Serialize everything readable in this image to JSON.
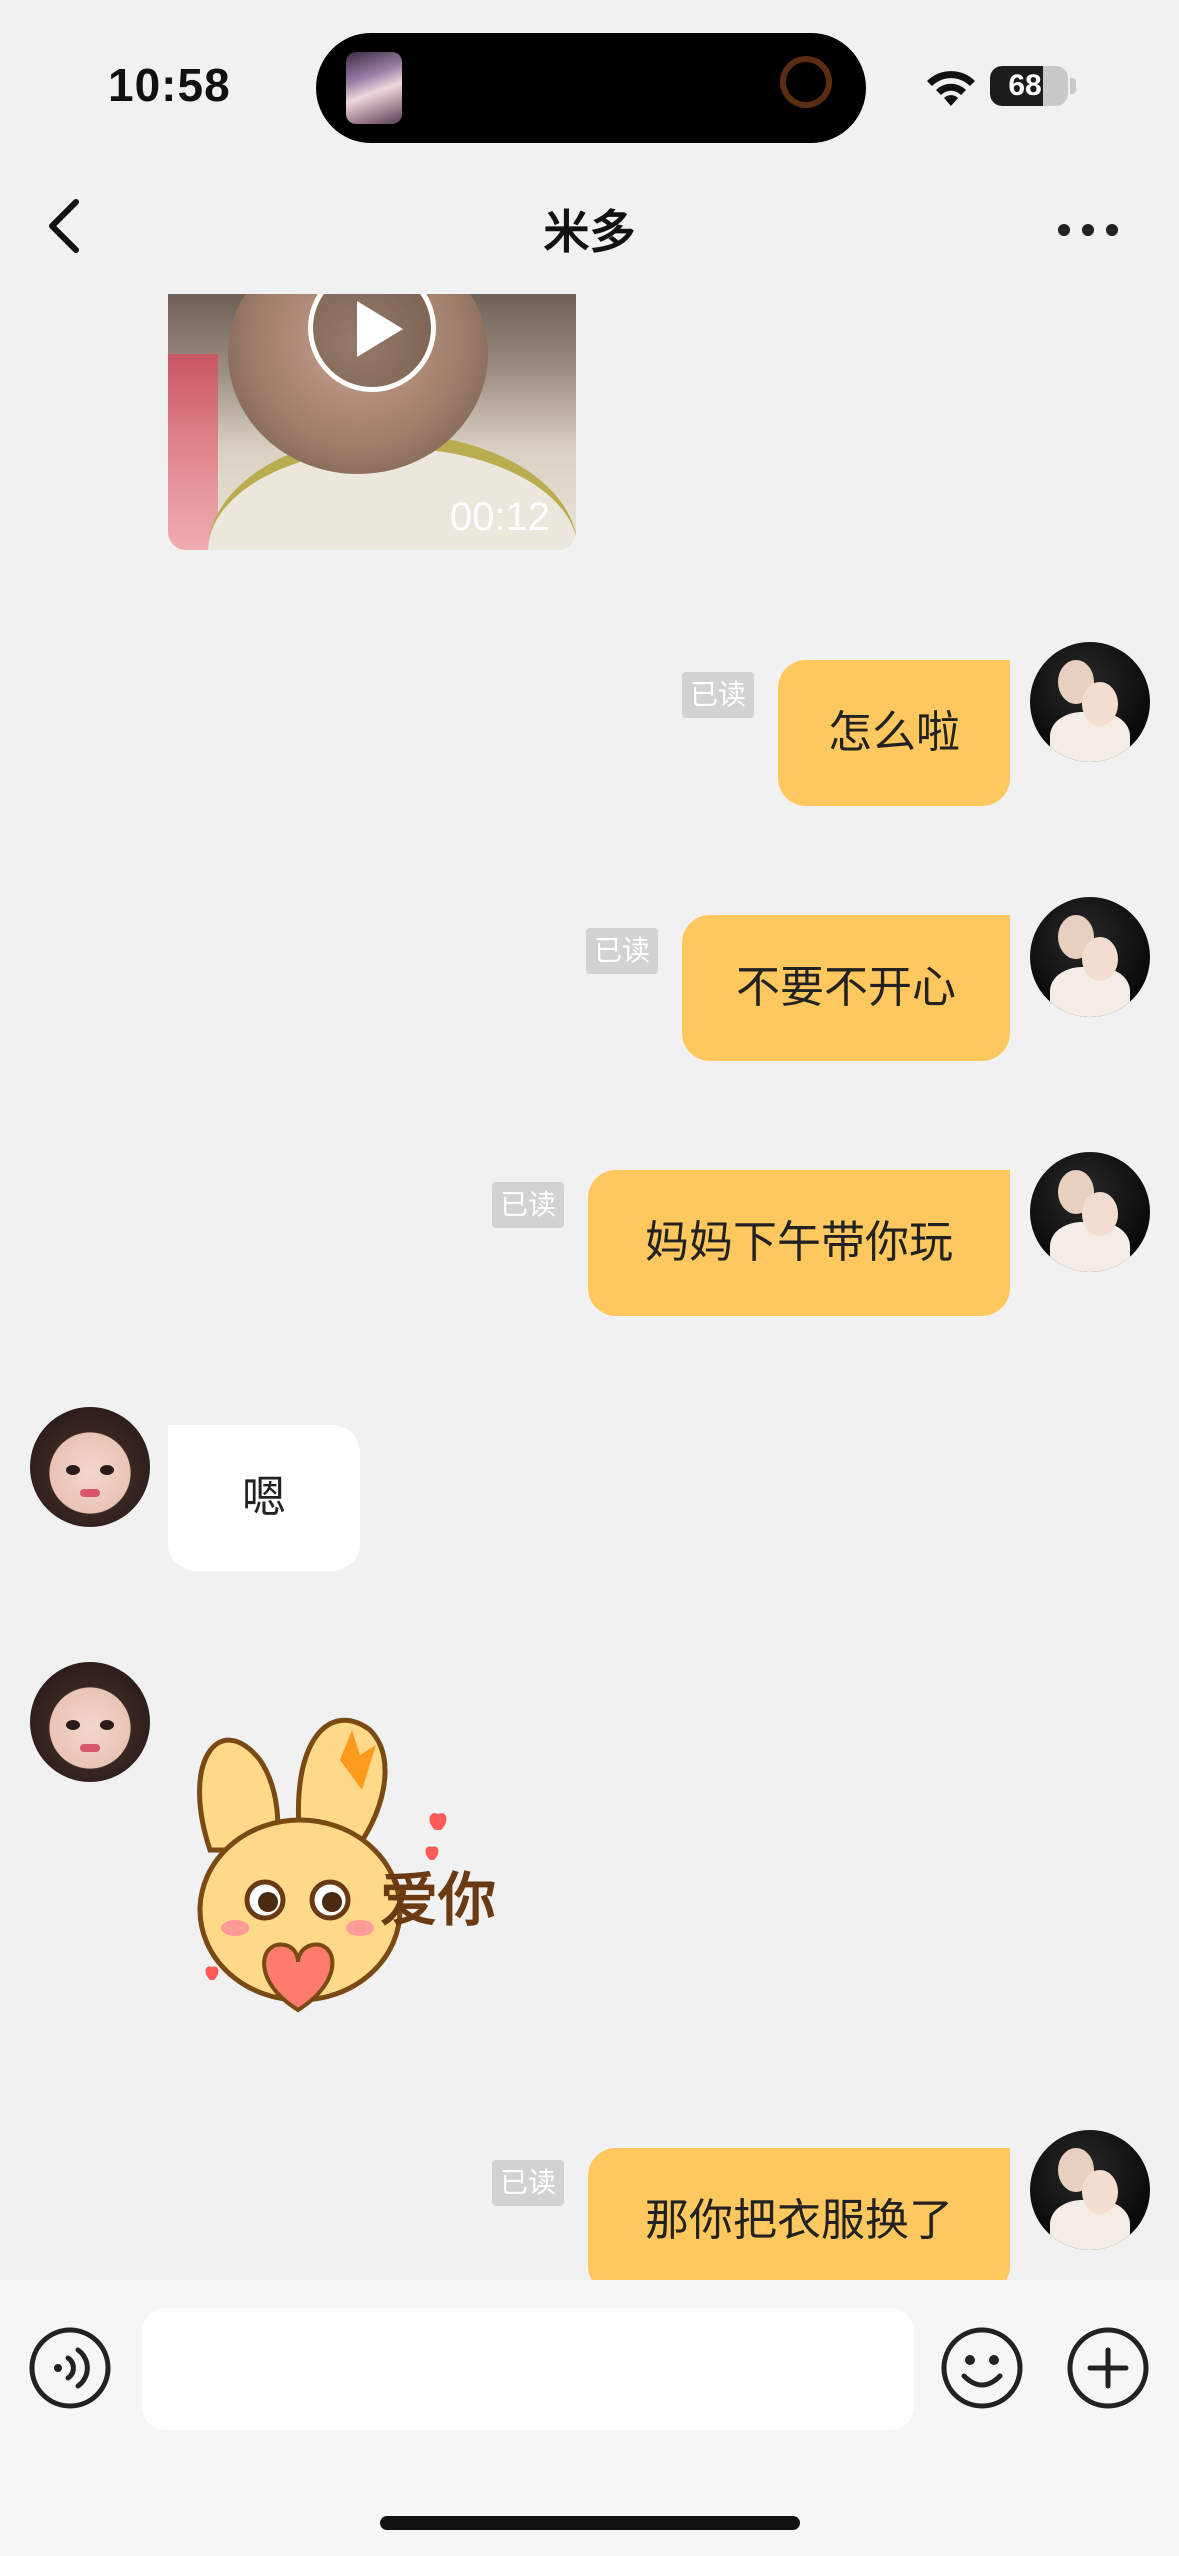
{
  "status_bar": {
    "time": "10:58",
    "battery": "68",
    "battery_level": 0.68
  },
  "nav": {
    "title": "米多"
  },
  "video": {
    "duration": "00:12"
  },
  "messages": [
    {
      "side": "out",
      "text": "怎么啦",
      "read": "已读"
    },
    {
      "side": "out",
      "text": "不要不开心",
      "read": "已读"
    },
    {
      "side": "out",
      "text": "妈妈下午带你玩",
      "read": "已读"
    },
    {
      "side": "in",
      "text": "嗯"
    },
    {
      "side": "in",
      "sticker_text": "爱你"
    },
    {
      "side": "out",
      "text": "那你把衣服换了",
      "read": "已读"
    }
  ],
  "colors": {
    "outgoing_bubble": "#ffc85e",
    "incoming_bubble": "#ffffff",
    "background": "#f1f1f1"
  },
  "icons": [
    "back-icon",
    "more-icon",
    "play-icon",
    "voice-icon",
    "emoji-icon",
    "plus-icon",
    "wifi-icon",
    "battery-icon"
  ]
}
